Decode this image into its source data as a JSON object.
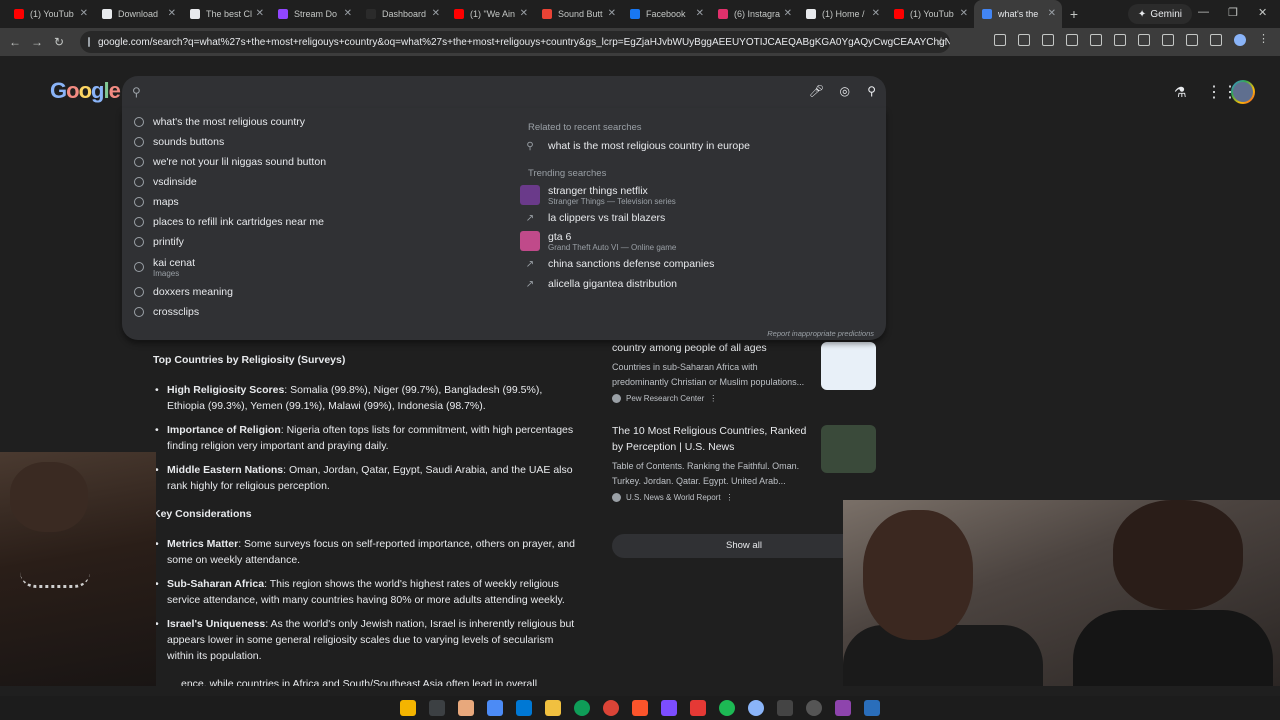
{
  "browser": {
    "tabs": [
      {
        "label": "(1) YouTub",
        "color": "#ff0000"
      },
      {
        "label": "Download",
        "color": "#e8eaed"
      },
      {
        "label": "The best Cl",
        "color": "#e8eaed"
      },
      {
        "label": "Stream Do",
        "color": "#9146ff"
      },
      {
        "label": "Dashboard",
        "color": "#2b2b2b"
      },
      {
        "label": "(1) \"We Ain",
        "color": "#ff0000"
      },
      {
        "label": "Sound Butt",
        "color": "#ea4335"
      },
      {
        "label": "Facebook",
        "color": "#1877f2"
      },
      {
        "label": "(6) Instagra",
        "color": "#e1306c"
      },
      {
        "label": "(1) Home /",
        "color": "#e8eaed"
      },
      {
        "label": "(1) YouTub",
        "color": "#ff0000"
      },
      {
        "label": "what's the",
        "color": "#4285f4"
      }
    ],
    "gemini_label": "Gemini",
    "url": "google.com/search?q=what%27s+the+most+religouys+country&oq=what%27s+the+most+religouys+country&gs_lcrp=EgZjaHJvbWUyBggAEEUYOTIJCAEQABgKGA0YgAQyCwgCEAAYChgNGIAEMg..."
  },
  "search": {
    "history_suggestions": [
      {
        "text": "what's the most religious country"
      },
      {
        "text": "sounds buttons"
      },
      {
        "text": "we're not your lil niggas sound button"
      },
      {
        "text": "vsdinside"
      },
      {
        "text": "maps"
      },
      {
        "text": "places to refill ink cartridges near me"
      },
      {
        "text": "printify"
      },
      {
        "text": "kai cenat",
        "sub": "Images"
      },
      {
        "text": "doxxers meaning"
      },
      {
        "text": "crossclips"
      }
    ],
    "related_header": "Related to recent searches",
    "related": [
      {
        "text": "what is the most religious country in europe"
      }
    ],
    "trending_header": "Trending searches",
    "trending": [
      {
        "text": "stranger things netflix",
        "sub": "Stranger Things — Television series",
        "thumb": true
      },
      {
        "text": "la clippers vs trail blazers"
      },
      {
        "text": "gta 6",
        "sub": "Grand Theft Auto VI — Online game",
        "thumb": true
      },
      {
        "text": "china sanctions defense companies"
      },
      {
        "text": "alicella gigantea distribution"
      }
    ],
    "report_label": "Report inappropriate predictions"
  },
  "ai_overview": {
    "heading1": "Top Countries by Religiosity (Surveys)",
    "bullets1": [
      {
        "bold": "High Religiosity Scores",
        "text": ": Somalia (99.8%), Niger (99.7%), Bangladesh (99.5%), Ethiopia (99.3%), Yemen (99.1%), Malawi (99%), Indonesia (98.7%)."
      },
      {
        "bold": "Importance of Religion",
        "text": ": Nigeria often tops lists for commitment, with high percentages finding religion very important and praying daily."
      },
      {
        "bold": "Middle Eastern Nations",
        "text": ": Oman, Jordan, Qatar, Egypt, Saudi Arabia, and the UAE also rank highly for religious perception."
      }
    ],
    "heading2": "Key Considerations",
    "bullets2": [
      {
        "bold": "Metrics Matter",
        "text": ": Some surveys focus on self-reported importance, others on prayer, and some on weekly attendance."
      },
      {
        "bold": "Sub-Saharan Africa",
        "text": ": This region shows the world's highest rates of weekly religious service attendance, with many countries having 80% or more adults attending weekly."
      },
      {
        "bold": "Israel's Uniqueness",
        "text": ": As the world's only Jewish nation, Israel is inherently religious but appears lower in some general religiosity scales due to varying levels of secularism within its population."
      }
    ],
    "tail": "ence, while countries in Africa and South/Southeast Asia often lead in overall"
  },
  "results": [
    {
      "title": "country among people of all ages",
      "desc": "Countries in sub-Saharan Africa with predominantly Christian or Muslim populations...",
      "source": "Pew Research Center",
      "img_color": "#e8f0f8"
    },
    {
      "title": "The 10 Most Religious Countries, Ranked by Perception | U.S. News",
      "desc": "Table of Contents. Ranking the Faithful. Oman. Turkey. Jordan. Qatar. Egypt. United Arab...",
      "source": "U.S. News & World Report",
      "img_color": "#3a4a3a"
    }
  ],
  "show_all_label": "Show all"
}
